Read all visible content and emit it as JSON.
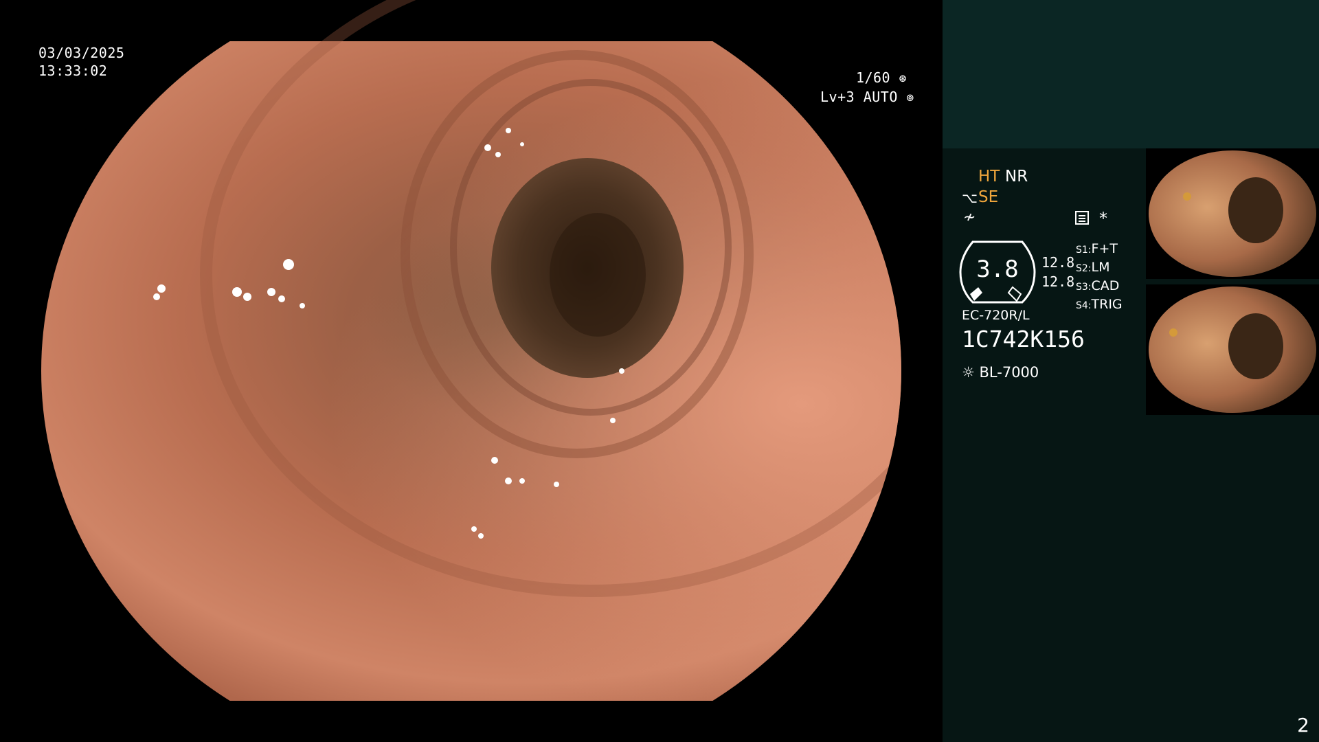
{
  "datetime": {
    "date": "03/03/2025",
    "time": "13:33:02"
  },
  "exposure": {
    "shutter": "1/60",
    "iris": "Lv+3 AUTO"
  },
  "enhance": {
    "ht": "HT",
    "nr": "NR",
    "se": "SE"
  },
  "gauge": {
    "value": "3.8",
    "left_top": "12.8",
    "left_bottom": "12.8"
  },
  "switches": [
    {
      "key": "S1",
      "value": "F+T"
    },
    {
      "key": "S2",
      "value": "LM"
    },
    {
      "key": "S3",
      "value": "CAD"
    },
    {
      "key": "S4",
      "value": "TRIG"
    }
  ],
  "scope": {
    "model": "EC-720R/L",
    "serial": "1C742K156"
  },
  "light_source": {
    "model": "BL-7000"
  },
  "asterisk": "*",
  "page_number": "2",
  "colors": {
    "panel_bg": "#061614",
    "panel_top": "#0b2624",
    "accent": "#f0a63c",
    "tissue": "#c57a5c"
  }
}
